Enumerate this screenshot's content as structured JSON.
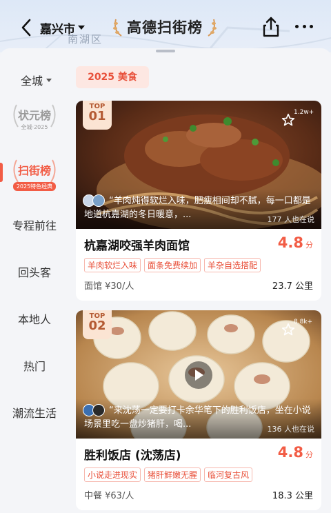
{
  "header": {
    "city": "嘉兴市",
    "brand_title": "高德扫街榜",
    "map_label": "南湖区"
  },
  "sidebar": {
    "all": "全城",
    "champion": {
      "title": "状元榜",
      "sub": "全城·2025"
    },
    "street": {
      "title": "扫街榜",
      "sub": "2025特色经典"
    },
    "items": [
      "专程前往",
      "回头客",
      "本地人",
      "热门",
      "潮流生活"
    ]
  },
  "tag_chip": "2025 美食",
  "cards": [
    {
      "rank_top": "TOP",
      "rank_num": "01",
      "fav_count": "1.2w+",
      "review": "“羊肉炖得软烂入味，肥瘦相间却不腻，每一口都是地道杭嘉湖的冬日暖意，...",
      "visits": "177 人也在说",
      "name": "杭嘉湖咬强羊肉面馆",
      "score": "4.8",
      "score_unit": "分",
      "tags": [
        "羊肉软烂入味",
        "面条免费续加",
        "羊杂自选搭配"
      ],
      "category_price": "面馆 ¥30/人",
      "distance": "23.7 公里"
    },
    {
      "rank_top": "TOP",
      "rank_num": "02",
      "fav_count": "8.8k+",
      "review": "“来沈荡一定要打卡余华笔下的胜利饭店，坐在小说场景里吃一盘炒猪肝，喝...",
      "visits": "136 人也在说",
      "name": "胜利饭店 (沈荡店)",
      "score": "4.8",
      "score_unit": "分",
      "tags": [
        "小说走进现实",
        "猪肝鲜嫩无腥",
        "临河复古风"
      ],
      "category_price": "中餐 ¥63/人",
      "distance": "18.3 公里"
    }
  ],
  "colors": {
    "accent": "#f25c45",
    "chip_bg": "#fde7e2",
    "rank_bg": "#fbe4d3"
  },
  "icons": [
    "back-arrow-icon",
    "share-icon",
    "more-icon",
    "star-icon",
    "play-icon",
    "laurel-icon"
  ]
}
